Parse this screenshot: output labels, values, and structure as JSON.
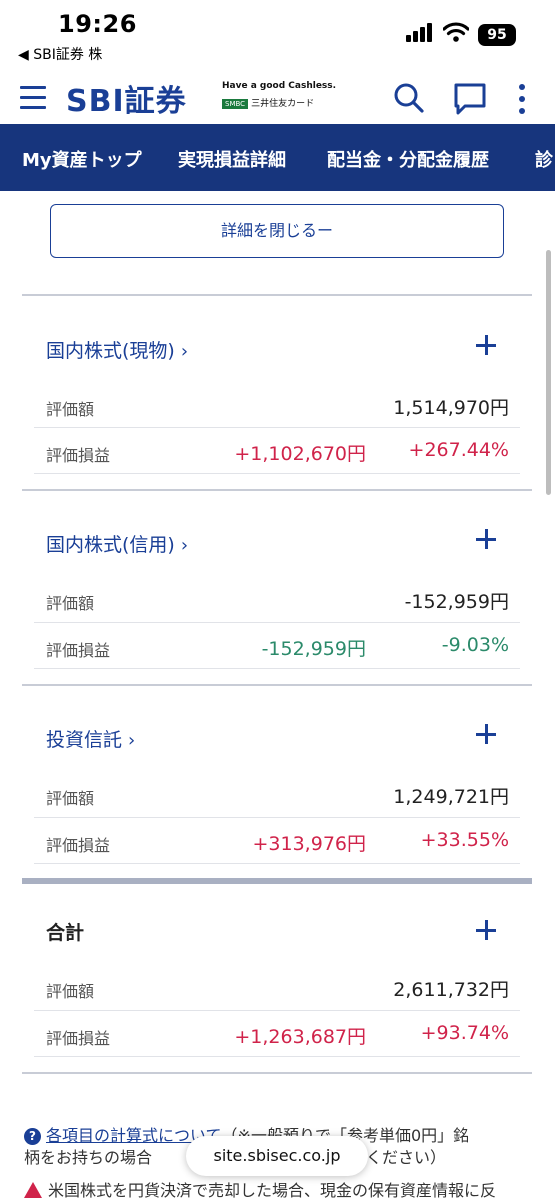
{
  "status_bar": {
    "time": "19:26",
    "back_app": "◀ SBI証券 株",
    "battery": "95"
  },
  "header": {
    "logo": "SBI証券",
    "tagline": "Have a good Cashless.",
    "smbc_badge": "SMBC",
    "card_name": "三井住友カード",
    "icons": [
      "menu-icon",
      "search-icon",
      "chat-icon",
      "more-vertical-icon"
    ]
  },
  "nav": {
    "tabs": [
      "My資産トップ",
      "実現損益詳細",
      "配当金・分配金履歴",
      "診"
    ]
  },
  "collapse_button": "詳細を閉じるー",
  "sections": [
    {
      "title": "国内株式(現物)",
      "chevron": "›",
      "valuation_label": "評価額",
      "valuation": "1,514,970円",
      "pl_label": "評価損益",
      "pl_amount": "+1,102,670円",
      "pl_percent": "+267.44%"
    },
    {
      "title": "国内株式(信用)",
      "chevron": "›",
      "valuation_label": "評価額",
      "valuation": "-152,959円",
      "pl_label": "評価損益",
      "pl_amount": "-152,959円",
      "pl_percent": "-9.03%"
    },
    {
      "title": "投資信託",
      "chevron": "›",
      "valuation_label": "評価額",
      "valuation": "1,249,721円",
      "pl_label": "評価損益",
      "pl_amount": "+313,976円",
      "pl_percent": "+33.55%"
    }
  ],
  "total": {
    "title": "合計",
    "valuation_label": "評価額",
    "valuation": "2,611,732円",
    "pl_label": "評価損益",
    "pl_amount": "+1,263,687円",
    "pl_percent": "+93.74%"
  },
  "notes": {
    "formula_link": "各項目の計算式について",
    "formula_text_1": "（※一般預りで「参考単価0円」銘",
    "formula_text_2": "柄をお持ちの場合",
    "formula_text_3": "をご確認ください）",
    "warning_text": "米国株式を円貨決済で売却した場合、現金の保有資産情報に反"
  },
  "url_bar": "site.sbisec.co.jp",
  "colors": {
    "brand_blue": "#1a3f96",
    "nav_bg": "#17357d",
    "gain_red": "#d0234a",
    "loss_green": "#2b8a6a"
  }
}
